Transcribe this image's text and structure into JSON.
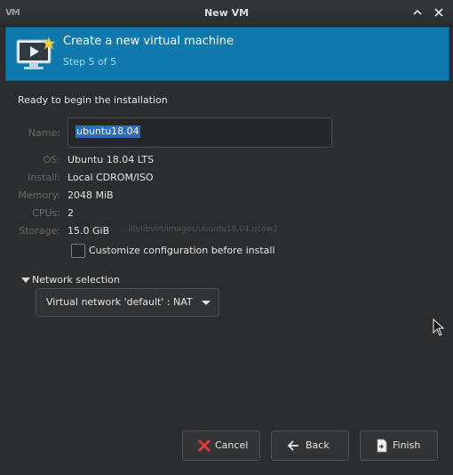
{
  "window": {
    "logo": "VM",
    "title": "New VM"
  },
  "banner": {
    "title": "Create a new virtual machine",
    "step": "Step 5 of 5"
  },
  "ready_text": "Ready to begin the installation",
  "summary": {
    "name_label": "Name:",
    "name_value": "ubuntu18.04",
    "os_label": "OS:",
    "os_value": "Ubuntu 18.04 LTS",
    "install_label": "Install:",
    "install_value": "Local CDROM/ISO",
    "memory_label": "Memory:",
    "memory_value": "2048 MiB",
    "cpus_label": "CPUs:",
    "cpus_value": "2",
    "storage_label": "Storage:",
    "storage_value": "15.0 GiB",
    "storage_path": "...lib/libvirt/images/ubuntu18.04.qcow2"
  },
  "customize": {
    "label": "Customize configuration before install",
    "checked": false
  },
  "network": {
    "expander_label": "Network selection",
    "selected": "Virtual network 'default' : NAT"
  },
  "buttons": {
    "cancel": "Cancel",
    "back": "Back",
    "finish": "Finish"
  },
  "colors": {
    "banner": "#0e79ad",
    "background": "#2c2d2e",
    "selection": "#2f6dba",
    "cancel_icon": "#e03a3a"
  }
}
